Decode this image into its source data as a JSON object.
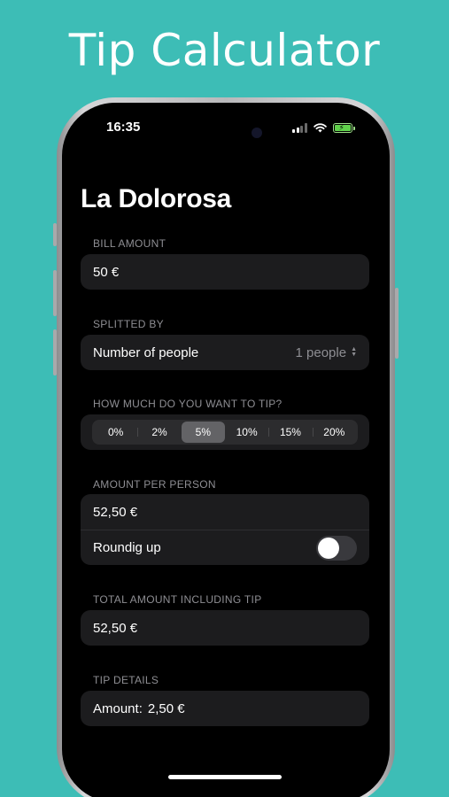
{
  "headline": "Tip Calculator",
  "status": {
    "time": "16:35"
  },
  "nav": {
    "title": "La Dolorosa"
  },
  "bill": {
    "label": "BILL AMOUNT",
    "value": "50 €"
  },
  "split": {
    "label": "SPLITTED BY",
    "row_label": "Number of people",
    "row_value": "1 people"
  },
  "tip": {
    "label": "HOW MUCH DO YOU WANT TO TIP?",
    "options": [
      "0%",
      "2%",
      "5%",
      "10%",
      "15%",
      "20%"
    ],
    "selected": "5%"
  },
  "per_person": {
    "label": "AMOUNT PER PERSON",
    "value": "52,50 €",
    "rounding_label": "Roundig up",
    "rounding_on": false
  },
  "total": {
    "label": "TOTAL AMOUNT INCLUDING TIP",
    "value": "52,50 €"
  },
  "details": {
    "label": "TIP DETAILS",
    "amount_label": "Amount:",
    "amount_value": "2,50 €"
  },
  "colors": {
    "background": "#3dbdb6",
    "screen": "#000000",
    "card": "#1c1c1e",
    "muted_text": "#8e8e93"
  }
}
